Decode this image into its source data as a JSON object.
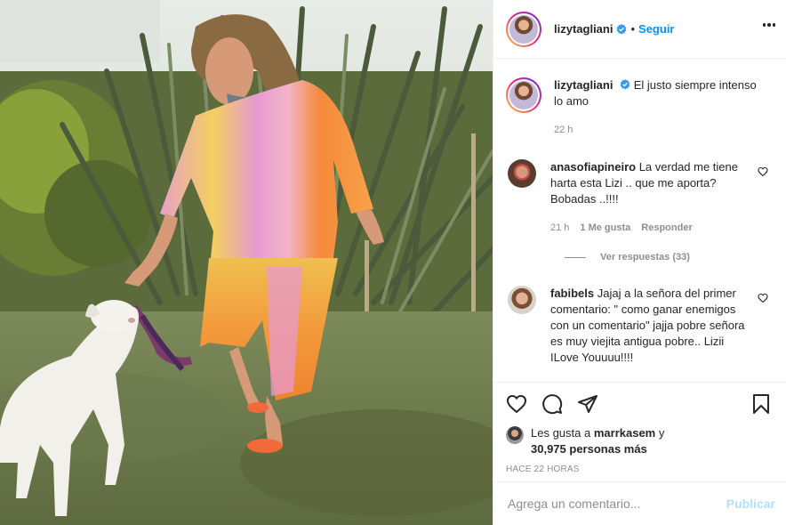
{
  "post": {
    "author": "lizytagliani",
    "follow_label": "Seguir",
    "separator": "•",
    "more_icon": "more-horizontal-icon"
  },
  "caption": {
    "username": "lizytagliani",
    "text": "El justo siempre intenso lo amo",
    "time": "22 h"
  },
  "comments": [
    {
      "username": "anasofiapineiro",
      "text": "La verdad me tiene harta esta Lizi .. que me aporta? Bobadas ..!!!!",
      "time": "21 h",
      "likes": "1 Me gusta",
      "reply_label": "Responder",
      "view_replies": "Ver respuestas (33)"
    },
    {
      "username": "fabibels",
      "text": "Jajaj a la señora del primer comentario: \" como ganar enemigos con un comentario\" jajja pobre señora es muy viejita antigua pobre.. Lizii ILove Youuuu!!!!"
    }
  ],
  "likes": {
    "prefix": "Les gusta a",
    "user": "marrkasem",
    "conj": "y",
    "count": "30,975 personas más"
  },
  "timeago": "HACE 22 HORAS",
  "composer": {
    "placeholder": "Agrega un comentario...",
    "publish_label": "Publicar"
  },
  "colors": {
    "link_blue": "#0095f6",
    "publish_disabled": "#b2dffc",
    "muted": "#8e8e8e"
  }
}
